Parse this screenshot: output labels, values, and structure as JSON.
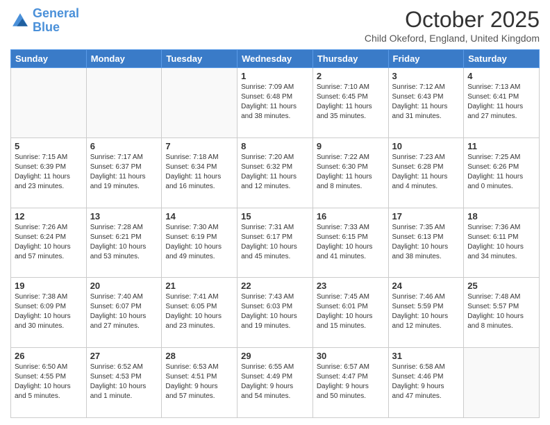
{
  "header": {
    "logo_line1": "General",
    "logo_line2": "Blue",
    "month_title": "October 2025",
    "location": "Child Okeford, England, United Kingdom"
  },
  "days_of_week": [
    "Sunday",
    "Monday",
    "Tuesday",
    "Wednesday",
    "Thursday",
    "Friday",
    "Saturday"
  ],
  "weeks": [
    [
      {
        "day": "",
        "info": ""
      },
      {
        "day": "",
        "info": ""
      },
      {
        "day": "",
        "info": ""
      },
      {
        "day": "1",
        "info": "Sunrise: 7:09 AM\nSunset: 6:48 PM\nDaylight: 11 hours\nand 38 minutes."
      },
      {
        "day": "2",
        "info": "Sunrise: 7:10 AM\nSunset: 6:45 PM\nDaylight: 11 hours\nand 35 minutes."
      },
      {
        "day": "3",
        "info": "Sunrise: 7:12 AM\nSunset: 6:43 PM\nDaylight: 11 hours\nand 31 minutes."
      },
      {
        "day": "4",
        "info": "Sunrise: 7:13 AM\nSunset: 6:41 PM\nDaylight: 11 hours\nand 27 minutes."
      }
    ],
    [
      {
        "day": "5",
        "info": "Sunrise: 7:15 AM\nSunset: 6:39 PM\nDaylight: 11 hours\nand 23 minutes."
      },
      {
        "day": "6",
        "info": "Sunrise: 7:17 AM\nSunset: 6:37 PM\nDaylight: 11 hours\nand 19 minutes."
      },
      {
        "day": "7",
        "info": "Sunrise: 7:18 AM\nSunset: 6:34 PM\nDaylight: 11 hours\nand 16 minutes."
      },
      {
        "day": "8",
        "info": "Sunrise: 7:20 AM\nSunset: 6:32 PM\nDaylight: 11 hours\nand 12 minutes."
      },
      {
        "day": "9",
        "info": "Sunrise: 7:22 AM\nSunset: 6:30 PM\nDaylight: 11 hours\nand 8 minutes."
      },
      {
        "day": "10",
        "info": "Sunrise: 7:23 AM\nSunset: 6:28 PM\nDaylight: 11 hours\nand 4 minutes."
      },
      {
        "day": "11",
        "info": "Sunrise: 7:25 AM\nSunset: 6:26 PM\nDaylight: 11 hours\nand 0 minutes."
      }
    ],
    [
      {
        "day": "12",
        "info": "Sunrise: 7:26 AM\nSunset: 6:24 PM\nDaylight: 10 hours\nand 57 minutes."
      },
      {
        "day": "13",
        "info": "Sunrise: 7:28 AM\nSunset: 6:21 PM\nDaylight: 10 hours\nand 53 minutes."
      },
      {
        "day": "14",
        "info": "Sunrise: 7:30 AM\nSunset: 6:19 PM\nDaylight: 10 hours\nand 49 minutes."
      },
      {
        "day": "15",
        "info": "Sunrise: 7:31 AM\nSunset: 6:17 PM\nDaylight: 10 hours\nand 45 minutes."
      },
      {
        "day": "16",
        "info": "Sunrise: 7:33 AM\nSunset: 6:15 PM\nDaylight: 10 hours\nand 41 minutes."
      },
      {
        "day": "17",
        "info": "Sunrise: 7:35 AM\nSunset: 6:13 PM\nDaylight: 10 hours\nand 38 minutes."
      },
      {
        "day": "18",
        "info": "Sunrise: 7:36 AM\nSunset: 6:11 PM\nDaylight: 10 hours\nand 34 minutes."
      }
    ],
    [
      {
        "day": "19",
        "info": "Sunrise: 7:38 AM\nSunset: 6:09 PM\nDaylight: 10 hours\nand 30 minutes."
      },
      {
        "day": "20",
        "info": "Sunrise: 7:40 AM\nSunset: 6:07 PM\nDaylight: 10 hours\nand 27 minutes."
      },
      {
        "day": "21",
        "info": "Sunrise: 7:41 AM\nSunset: 6:05 PM\nDaylight: 10 hours\nand 23 minutes."
      },
      {
        "day": "22",
        "info": "Sunrise: 7:43 AM\nSunset: 6:03 PM\nDaylight: 10 hours\nand 19 minutes."
      },
      {
        "day": "23",
        "info": "Sunrise: 7:45 AM\nSunset: 6:01 PM\nDaylight: 10 hours\nand 15 minutes."
      },
      {
        "day": "24",
        "info": "Sunrise: 7:46 AM\nSunset: 5:59 PM\nDaylight: 10 hours\nand 12 minutes."
      },
      {
        "day": "25",
        "info": "Sunrise: 7:48 AM\nSunset: 5:57 PM\nDaylight: 10 hours\nand 8 minutes."
      }
    ],
    [
      {
        "day": "26",
        "info": "Sunrise: 6:50 AM\nSunset: 4:55 PM\nDaylight: 10 hours\nand 5 minutes."
      },
      {
        "day": "27",
        "info": "Sunrise: 6:52 AM\nSunset: 4:53 PM\nDaylight: 10 hours\nand 1 minute."
      },
      {
        "day": "28",
        "info": "Sunrise: 6:53 AM\nSunset: 4:51 PM\nDaylight: 9 hours\nand 57 minutes."
      },
      {
        "day": "29",
        "info": "Sunrise: 6:55 AM\nSunset: 4:49 PM\nDaylight: 9 hours\nand 54 minutes."
      },
      {
        "day": "30",
        "info": "Sunrise: 6:57 AM\nSunset: 4:47 PM\nDaylight: 9 hours\nand 50 minutes."
      },
      {
        "day": "31",
        "info": "Sunrise: 6:58 AM\nSunset: 4:46 PM\nDaylight: 9 hours\nand 47 minutes."
      },
      {
        "day": "",
        "info": ""
      }
    ]
  ]
}
